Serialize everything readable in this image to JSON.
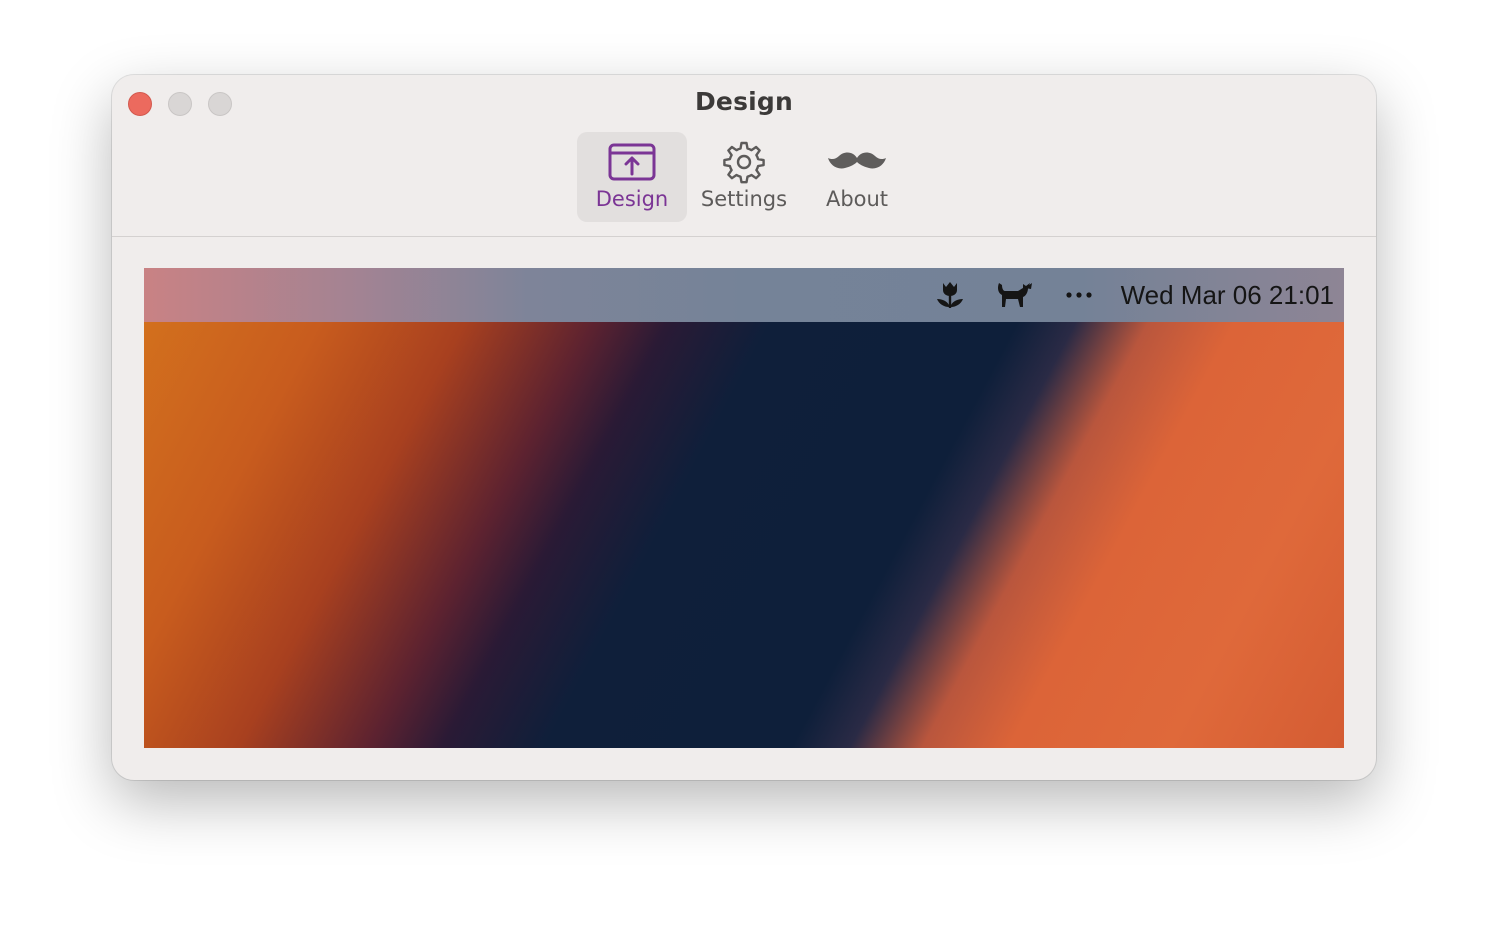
{
  "window": {
    "title": "Design"
  },
  "toolbar": {
    "tabs": [
      {
        "label": "Design",
        "icon": "menubar-design-icon",
        "selected": true
      },
      {
        "label": "Settings",
        "icon": "gear-icon",
        "selected": false
      },
      {
        "label": "About",
        "icon": "mustache-icon",
        "selected": false
      }
    ],
    "accent_color": "#7b3595"
  },
  "preview": {
    "menubar": {
      "icons": [
        "tulip-icon",
        "cat-icon",
        "ellipsis-icon"
      ],
      "clock": "Wed Mar 06 21:01"
    }
  }
}
